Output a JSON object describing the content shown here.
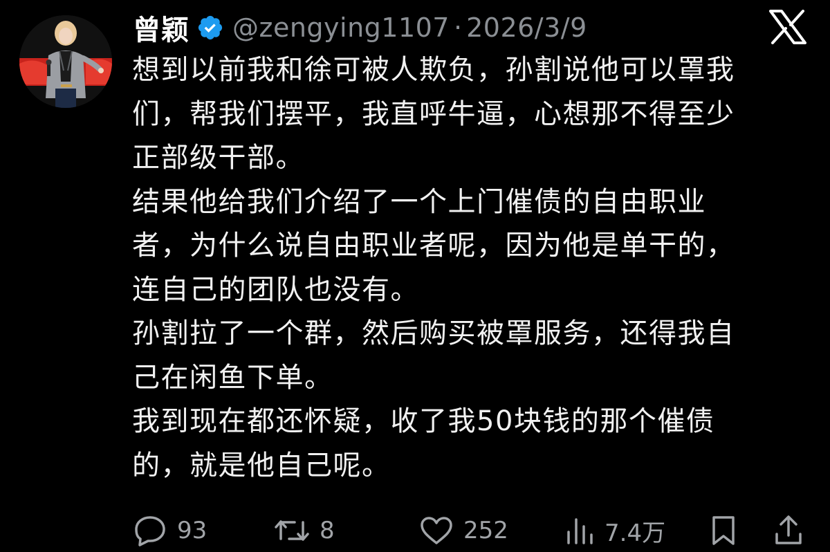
{
  "author": {
    "display_name": "曾颖",
    "handle": "@zengying1107",
    "separator": "·",
    "date": "2026/3/9"
  },
  "tweet": {
    "lines": [
      "想到以前我和徐可被人欺负，孙割说他可以罩我",
      "们，帮我们摆平，我直呼牛逼，心想那不得至少",
      "正部级干部。",
      "结果他给我们介绍了一个上门催债的自由职业",
      "者，为什么说自由职业者呢，因为他是单干的，",
      "连自己的团队也没有。",
      "孙割拉了一个群，然后购买被罩服务，还得我自",
      "己在闲鱼下单。",
      "我到现在都还怀疑，收了我50块钱的那个催债",
      "的，就是他自己呢。"
    ]
  },
  "actions": {
    "replies": "93",
    "reposts": "8",
    "likes": "252",
    "views": "7.4万"
  },
  "icons": {
    "verified": "verified-badge-icon",
    "brand": "x-logo-icon",
    "reply": "reply-icon",
    "repost": "repost-icon",
    "like": "heart-icon",
    "views": "views-icon",
    "bookmark": "bookmark-icon",
    "share": "share-icon"
  },
  "colors": {
    "background": "#000000",
    "text": "#f1f1f1",
    "muted": "#8b8f94",
    "verified": "#1d9bf0"
  }
}
